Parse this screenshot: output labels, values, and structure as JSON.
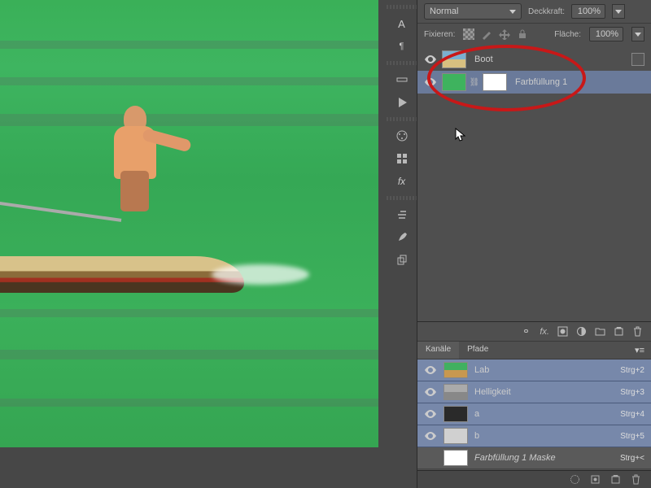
{
  "layers_panel": {
    "blend_mode": "Normal",
    "opacity_label": "Deckkraft:",
    "opacity_value": "100%",
    "lock_label": "Fixieren:",
    "fill_label": "Fläche:",
    "fill_value": "100%",
    "layers": [
      {
        "name": "Boot"
      },
      {
        "name": "Farbfüllung 1"
      }
    ]
  },
  "channels_panel": {
    "tabs": [
      "Kanäle",
      "Pfade"
    ],
    "channels": [
      {
        "name": "Lab",
        "shortcut": "Strg+2"
      },
      {
        "name": "Helligkeit",
        "shortcut": "Strg+3"
      },
      {
        "name": "a",
        "shortcut": "Strg+4"
      },
      {
        "name": "b",
        "shortcut": "Strg+5"
      },
      {
        "name": "Farbfüllung 1 Maske",
        "shortcut": "Strg+<"
      }
    ]
  }
}
